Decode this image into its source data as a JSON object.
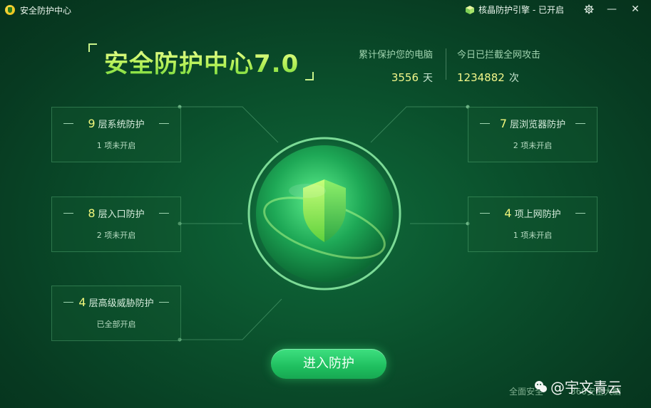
{
  "window": {
    "app_title": "安全防护中心",
    "engine_status": "核晶防护引擎 - 已开启"
  },
  "header": {
    "title": "安全防护中心7.0",
    "stats": [
      {
        "label": "累计保护您的电脑",
        "value": "3556",
        "unit": "天"
      },
      {
        "label": "今日已拦截全网攻击",
        "value": "1234882",
        "unit": "次"
      }
    ]
  },
  "cards": {
    "left": [
      {
        "num": "9",
        "title": "层系统防护",
        "status": "1 项未开启"
      },
      {
        "num": "8",
        "title": "层入口防护",
        "status": "2 项未开启"
      },
      {
        "num": "4",
        "title": "层高级威胁防护",
        "status": "已全部开启"
      }
    ],
    "right": [
      {
        "num": "7",
        "title": "层浏览器防护",
        "status": "2 项未开启"
      },
      {
        "num": "4",
        "title": "项上网防护",
        "status": "1 项未开启"
      }
    ]
  },
  "actions": {
    "enter_label": "进入防护"
  },
  "footer": {
    "left_text": "全面安全",
    "right_text": "360安全大脑",
    "watermark": "@宇文青云"
  },
  "colors": {
    "accent_yellow": "#f1f77c",
    "button_green": "#1fbf5f",
    "background": "#0a4e2b"
  },
  "icons": {
    "app": "shield-logo-icon",
    "engine": "cube-icon",
    "settings": "gear-icon",
    "minimize": "minimize-icon",
    "close": "close-icon",
    "center": "shield-orb-icon"
  }
}
